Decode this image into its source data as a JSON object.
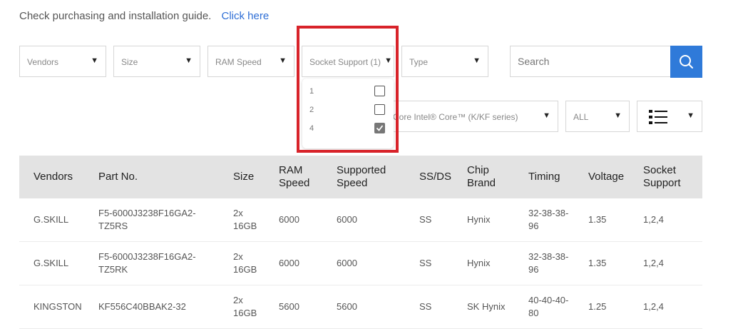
{
  "guide": {
    "text": "Check purchasing and installation guide.",
    "link": "Click here"
  },
  "filters": {
    "vendors": "Vendors",
    "size": "Size",
    "ram_speed": "RAM Speed",
    "socket_support": "Socket Support (1)",
    "type": "Type",
    "search_placeholder": "Search",
    "cpu": "Core Intel® Core™ (K/KF series)",
    "all": "ALL",
    "arrow": "▼"
  },
  "socket_dropdown": {
    "options": [
      {
        "label": "1",
        "checked": false
      },
      {
        "label": "2",
        "checked": false
      },
      {
        "label": "4",
        "checked": true
      }
    ]
  },
  "table": {
    "headers": [
      "Vendors",
      "Part No.",
      "Size",
      "RAM Speed",
      "Supported Speed",
      "SS/DS",
      "Chip Brand",
      "Timing",
      "Voltage",
      "Socket Support"
    ],
    "rows": [
      [
        "G.SKILL",
        "F5-6000J3238F16GA2-TZ5RS",
        "2x 16GB",
        "6000",
        "6000",
        "SS",
        "Hynix",
        "32-38-38-96",
        "1.35",
        "1,2,4"
      ],
      [
        "G.SKILL",
        "F5-6000J3238F16GA2-TZ5RK",
        "2x 16GB",
        "6000",
        "6000",
        "SS",
        "Hynix",
        "32-38-38-96",
        "1.35",
        "1,2,4"
      ],
      [
        "KINGSTON",
        "KF556C40BBAK2-32",
        "2x 16GB",
        "5600",
        "5600",
        "SS",
        "SK Hynix",
        "40-40-40-80",
        "1.25",
        "1,2,4"
      ]
    ]
  },
  "colors": {
    "accent": "#2f7ad9",
    "highlight": "#d8232a",
    "header_bg": "#e3e3e3"
  }
}
